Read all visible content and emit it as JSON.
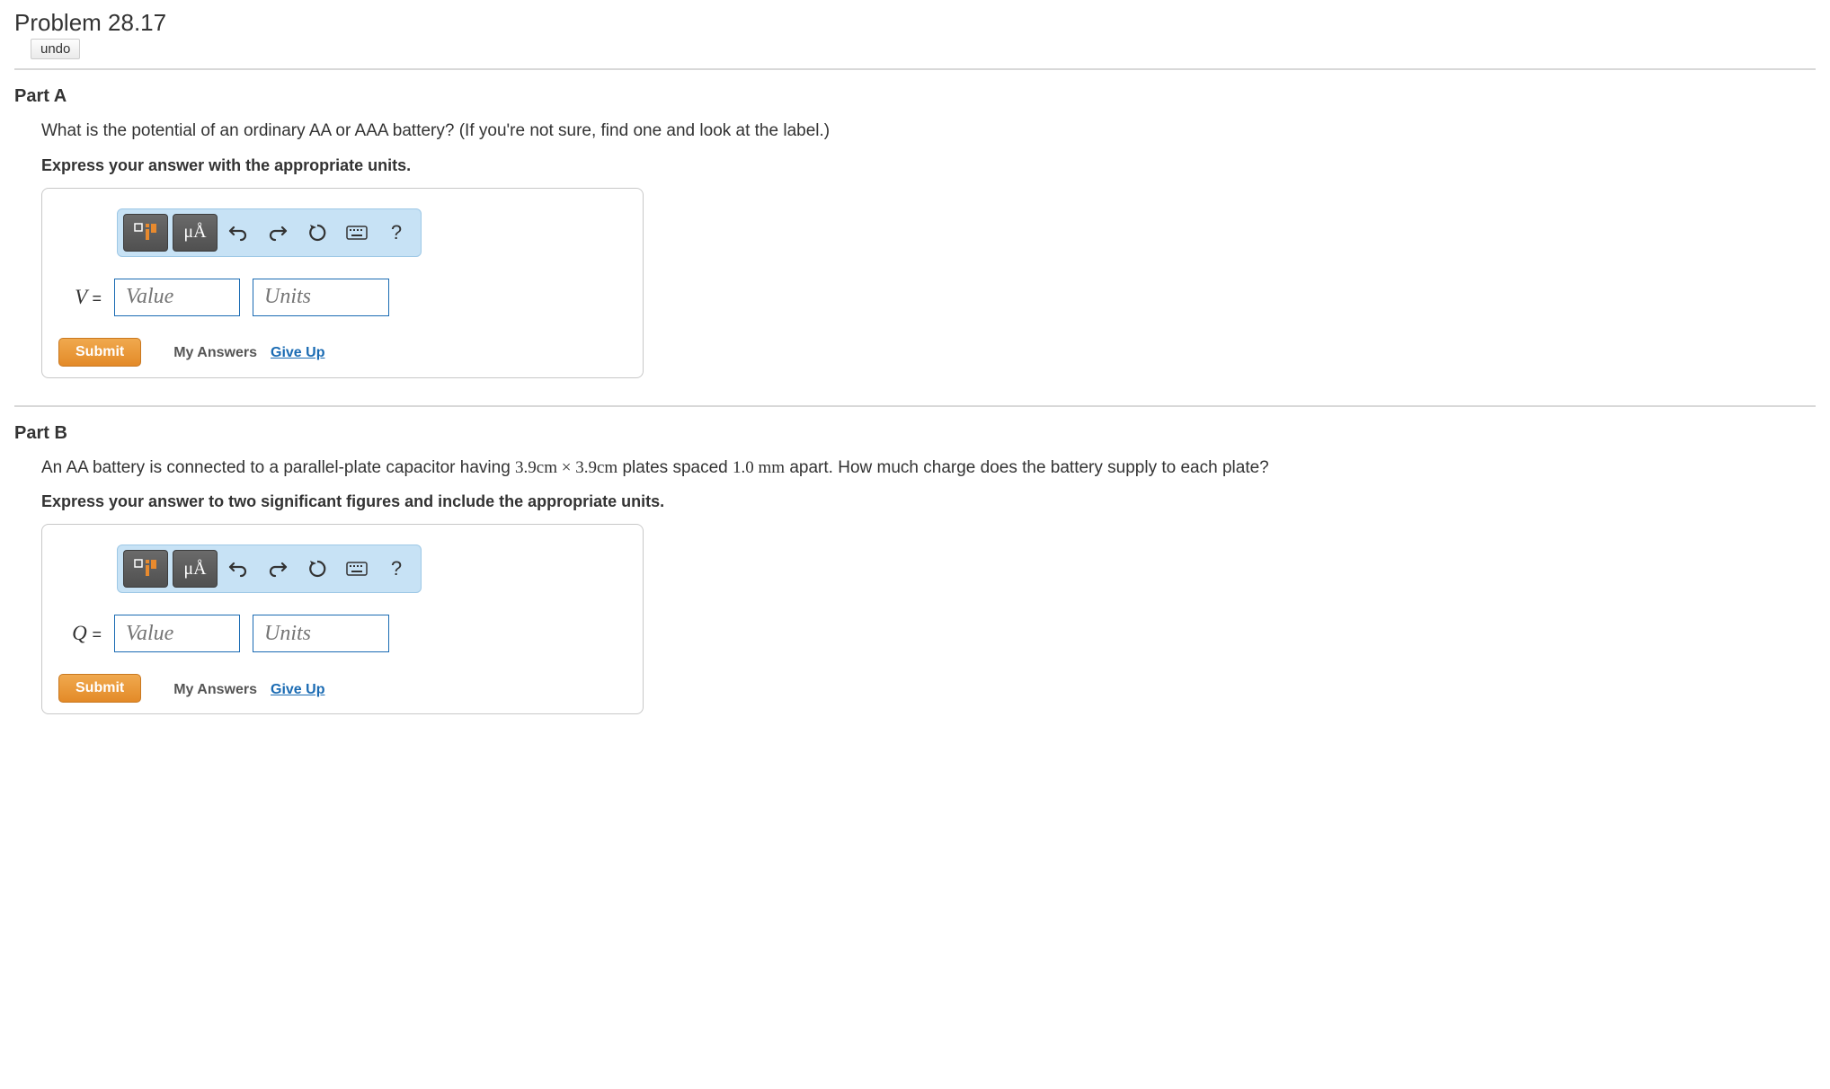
{
  "problem_title": "Problem 28.17",
  "undo_label": "undo",
  "partA": {
    "label": "Part A",
    "question": "What is the potential of an ordinary AA or AAA battery? (If you're not sure, find one and look at the label.)",
    "instruction": "Express your answer with the appropriate units.",
    "var": "V",
    "value_placeholder": "Value",
    "units_placeholder": "Units",
    "toolbar": {
      "templates_label": "μÅ",
      "help": "?"
    },
    "submit": "Submit",
    "my_answers": "My Answers",
    "give_up": "Give Up"
  },
  "partB": {
    "label": "Part B",
    "question_prefix": "An AA battery is connected to a parallel-plate capacitor having ",
    "dim1": "3.9cm",
    "times": " × ",
    "dim2": "3.9cm",
    "question_mid": " plates spaced ",
    "spacing_val": "1.0",
    "spacing_unit": " mm",
    "question_suffix": " apart. How much charge does the battery supply to each plate?",
    "instruction": "Express your answer to two significant figures and include the appropriate units.",
    "var": "Q",
    "value_placeholder": "Value",
    "units_placeholder": "Units",
    "toolbar": {
      "templates_label": "μÅ",
      "help": "?"
    },
    "submit": "Submit",
    "my_answers": "My Answers",
    "give_up": "Give Up"
  }
}
